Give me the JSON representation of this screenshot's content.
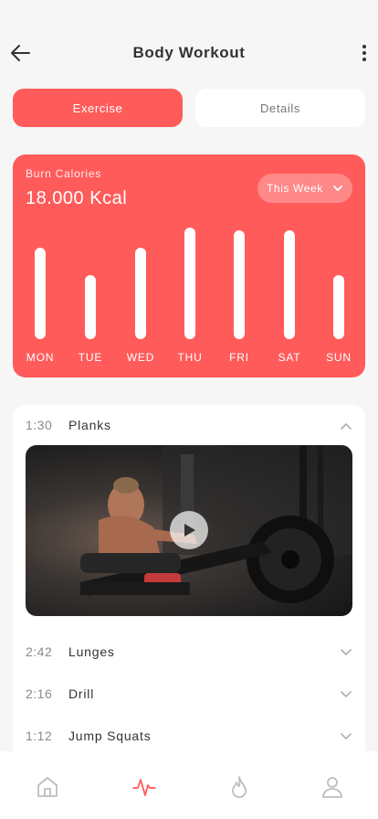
{
  "header": {
    "title": "Body Workout",
    "back_icon": "arrow-left-icon",
    "more_icon": "more-vertical-icon"
  },
  "tabs": [
    {
      "label": "Exercise",
      "active": true
    },
    {
      "label": "Details",
      "active": false
    }
  ],
  "calories": {
    "label": "Burn Calories",
    "value": "18.000 Kcal",
    "period": "This Week",
    "accent": "#ff5b5b",
    "chart_data": {
      "type": "bar",
      "categories": [
        "MON",
        "TUE",
        "WED",
        "THU",
        "FRI",
        "SAT",
        "SUN"
      ],
      "values": [
        100,
        70,
        100,
        122,
        119,
        119,
        70
      ],
      "title": "",
      "xlabel": "",
      "ylabel": "",
      "ylim": [
        0,
        122
      ]
    }
  },
  "exercises": [
    {
      "time": "1:30",
      "name": "Planks",
      "expanded": true,
      "chevron": "chevron-up-icon"
    },
    {
      "time": "2:42",
      "name": "Lunges",
      "expanded": false,
      "chevron": "chevron-down-icon"
    },
    {
      "time": "2:16",
      "name": "Drill",
      "expanded": false,
      "chevron": "chevron-down-icon"
    },
    {
      "time": "1:12",
      "name": "Jump Squats",
      "expanded": false,
      "chevron": "chevron-down-icon"
    }
  ],
  "video": {
    "icon": "play-icon"
  },
  "nav": {
    "items": [
      {
        "icon": "home-icon",
        "active": false
      },
      {
        "icon": "activity-icon",
        "active": true
      },
      {
        "icon": "flame-icon",
        "active": false
      },
      {
        "icon": "user-icon",
        "active": false
      }
    ],
    "active_color": "#ff5b5b",
    "inactive_color": "#bdbdbd"
  }
}
